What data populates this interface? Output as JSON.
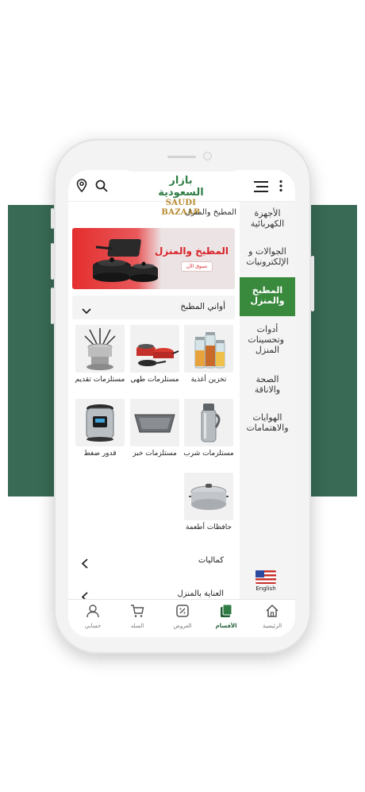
{
  "header": {
    "logo_ar": "بازار السعودية",
    "logo_en": "SAUDI BAZAAR",
    "icons": [
      "more-vertical-icon",
      "hamburger-menu-icon",
      "search-icon",
      "location-pin-icon"
    ]
  },
  "sidebar": {
    "items": [
      {
        "label": "الأجهزة الكهربائية"
      },
      {
        "label": "الجوالات و الإلكترونيات"
      },
      {
        "label": "المطبخ والمنزل"
      },
      {
        "label": "أدوات وتحسينات المنزل"
      },
      {
        "label": "الصحة والاناقة"
      },
      {
        "label": "الهوايات والاهتمامات"
      }
    ],
    "active_index": 2,
    "language_label": "English"
  },
  "content": {
    "breadcrumb": "المطبخ والمنزل",
    "banner": {
      "title": "المطبخ والمنزل",
      "button_label": "تسوق الآن"
    },
    "section": {
      "title": "أواني المطبخ",
      "expanded": true
    },
    "tiles": [
      {
        "label": "تخزين أغذية",
        "icon": "storage-jars-icon"
      },
      {
        "label": "مستلزمات طهي",
        "icon": "cookware-set-icon"
      },
      {
        "label": "مستلزمات تقديم",
        "icon": "fondue-set-icon"
      },
      {
        "label": "مستلزمات شرب",
        "icon": "thermos-icon"
      },
      {
        "label": "مستلزمات خبز",
        "icon": "baking-pan-icon"
      },
      {
        "label": "قدور ضغط",
        "icon": "pressure-cooker-icon"
      },
      {
        "label": "حافظات أطعمة",
        "icon": "food-warmer-icon"
      }
    ],
    "links": [
      {
        "label": "كماليات"
      },
      {
        "label": "العناية بالمنزل"
      }
    ]
  },
  "bottom_nav": {
    "items": [
      {
        "label": "الرئيسية",
        "icon": "home-icon"
      },
      {
        "label": "الأقسام",
        "icon": "categories-icon"
      },
      {
        "label": "العروض",
        "icon": "offers-icon"
      },
      {
        "label": "السله",
        "icon": "cart-icon"
      },
      {
        "label": "حسابي",
        "icon": "user-icon"
      }
    ],
    "active_index": 1
  },
  "colors": {
    "brand_green": "#386a55",
    "active_green": "#3a8a3e",
    "banner_red": "#d8232a",
    "logo_gold": "#b58a2e"
  }
}
